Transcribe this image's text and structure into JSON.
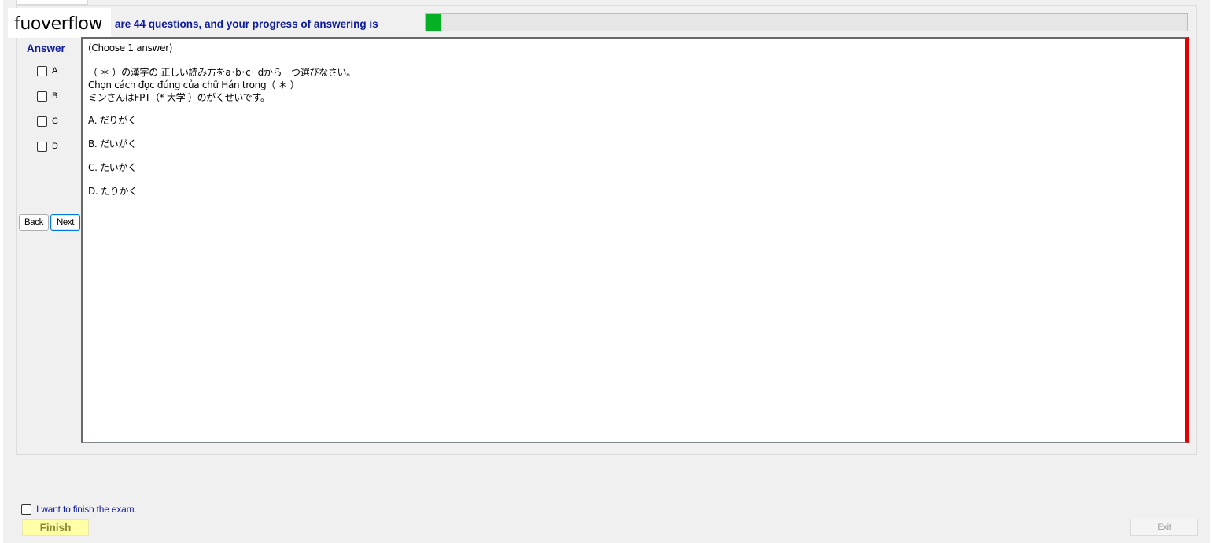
{
  "branding": {
    "watermark": "fuoverflow"
  },
  "progress": {
    "caption": "are 44 questions, and your progress of answering is",
    "percent": 2,
    "fill_color": "#06b025"
  },
  "answer_panel": {
    "heading": "Answer",
    "options": [
      {
        "label": "A",
        "checked": false
      },
      {
        "label": "B",
        "checked": false
      },
      {
        "label": "C",
        "checked": false
      },
      {
        "label": "D",
        "checked": false
      }
    ]
  },
  "navigation": {
    "back_label": "Back",
    "next_label": "Next"
  },
  "question": {
    "instruction": "(Choose 1 answer)",
    "lines": [
      "（ ＊ ）の漢字の 正しい読み方をa･b･c･ dから一つ選びなさい。",
      "Chọn cách đọc đúng của chữ Hán trong（ ＊ ）",
      "ミンさんはFPT（* 大学 ）のがくせいです。"
    ],
    "choices": [
      "A. だりがく",
      "B. だいがく",
      "C. たいかく",
      "D. たりかく"
    ]
  },
  "footer": {
    "finish_check_label": "I want to finish the exam.",
    "finish_label": "Finish",
    "exit_label": "Exit"
  },
  "colors": {
    "accent_text": "#0d1a9c",
    "question_border_right": "#e00000",
    "finish_bg": "#ffffa8"
  }
}
